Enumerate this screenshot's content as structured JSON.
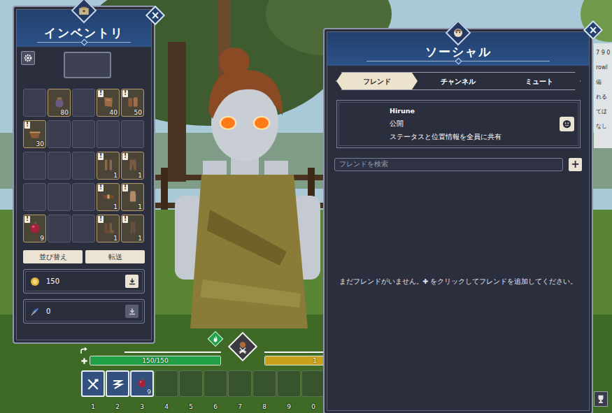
{
  "side_panel": {
    "lines": [
      "7 9 0",
      "rowl",
      "備",
      "れる",
      "てほ",
      "なし"
    ]
  },
  "inventory": {
    "title": "インベントリ",
    "close": "×",
    "slots": [
      {
        "kind": "empty"
      },
      {
        "kind": "pouch",
        "count": "80"
      },
      {
        "kind": "empty"
      },
      {
        "kind": "hide",
        "badge": "!",
        "count": "40"
      },
      {
        "kind": "log",
        "badge": "!",
        "count": "50"
      },
      {
        "kind": "basket",
        "badge": "!",
        "count": "30"
      },
      {
        "kind": "empty"
      },
      {
        "kind": "empty"
      },
      {
        "kind": "empty"
      },
      {
        "kind": "empty"
      },
      {
        "kind": "empty"
      },
      {
        "kind": "empty"
      },
      {
        "kind": "empty"
      },
      {
        "kind": "wraps",
        "badge": "!",
        "count": "1"
      },
      {
        "kind": "pants",
        "badge": "!",
        "count": "1"
      },
      {
        "kind": "empty"
      },
      {
        "kind": "empty"
      },
      {
        "kind": "empty"
      },
      {
        "kind": "belt",
        "badge": "!",
        "count": "1"
      },
      {
        "kind": "shirt",
        "badge": "!",
        "count": "1"
      },
      {
        "kind": "berry",
        "badge": "!",
        "count": "9"
      },
      {
        "kind": "empty"
      },
      {
        "kind": "empty"
      },
      {
        "kind": "boots",
        "badge": "!",
        "count": "1"
      },
      {
        "kind": "leggings",
        "badge": "!",
        "count": "1"
      }
    ],
    "buttons": [
      "並び替え",
      "転送"
    ],
    "currencies": [
      {
        "kind": "coin",
        "amount": "150",
        "enabled": true
      },
      {
        "kind": "feather",
        "amount": "0",
        "enabled": false
      }
    ]
  },
  "social": {
    "title": "ソーシャル",
    "close": "×",
    "tabs": [
      {
        "label": "フレンド",
        "selected": true
      },
      {
        "label": "チャンネル",
        "selected": false
      },
      {
        "label": "ミュート",
        "selected": false
      }
    ],
    "friend_card": {
      "name": "Hirune",
      "visibility": "公開",
      "description": "ステータスと位置情報を全員に共有"
    },
    "search": {
      "placeholder": "フレンドを検索"
    },
    "add_button": "+",
    "empty_message": "まだフレンドがいません。✚ をクリックしてフレンドを追加してください。"
  },
  "hud": {
    "health": {
      "reading": "150/150",
      "level": 1
    },
    "stamina": {
      "reading": "1",
      "level": 1
    },
    "hotbar": [
      {
        "key": "1",
        "kind": "tools"
      },
      {
        "key": "2",
        "kind": "glide"
      },
      {
        "key": "3",
        "kind": "berry",
        "count": "9"
      },
      {
        "key": "4",
        "kind": "empty"
      },
      {
        "key": "5",
        "kind": "empty"
      },
      {
        "key": "6",
        "kind": "empty"
      },
      {
        "key": "7",
        "kind": "empty"
      },
      {
        "key": "8",
        "kind": "empty"
      },
      {
        "key": "9",
        "kind": "empty"
      },
      {
        "key": "0",
        "kind": "empty"
      }
    ]
  }
}
